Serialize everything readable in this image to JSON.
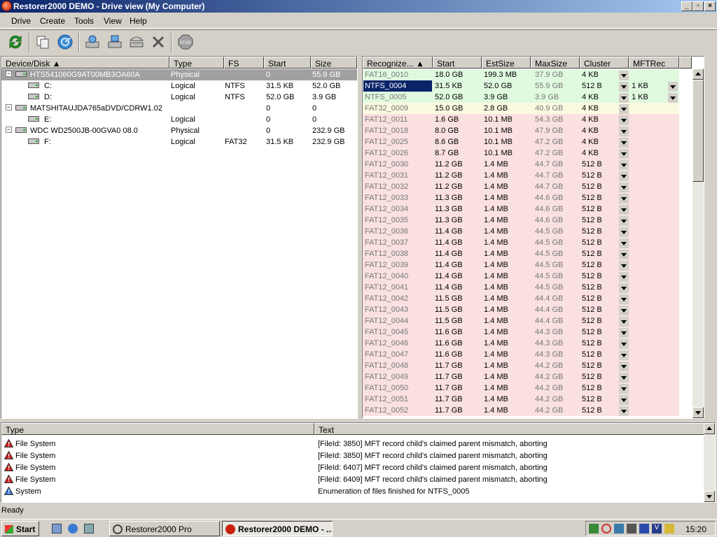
{
  "window": {
    "title": "Restorer2000 DEMO - Drive view (My Computer)"
  },
  "menu": [
    "Drive",
    "Create",
    "Tools",
    "View",
    "Help"
  ],
  "devices": {
    "columns": [
      "Device/Disk",
      "Type",
      "FS",
      "Start",
      "Size"
    ],
    "rows": [
      {
        "name": "HTS541060G9AT00MB3OA60A",
        "type": "Physical",
        "fs": "",
        "start": "0",
        "size": "55.9 GB"
      },
      {
        "name": "C:",
        "type": "Logical",
        "fs": "NTFS",
        "start": "31.5 KB",
        "size": "52.0 GB"
      },
      {
        "name": "D:",
        "type": "Logical",
        "fs": "NTFS",
        "start": "52.0 GB",
        "size": "3.9 GB"
      },
      {
        "name": "MATSHITAUJDA765aDVD/CDRW1.02",
        "type": "",
        "fs": "",
        "start": "0",
        "size": "0"
      },
      {
        "name": "E:",
        "type": "Logical",
        "fs": "",
        "start": "0",
        "size": "0"
      },
      {
        "name": "WDC WD2500JB-00GVA0 08.0",
        "type": "Physical",
        "fs": "",
        "start": "0",
        "size": "232.9 GB"
      },
      {
        "name": "F:",
        "type": "Logical",
        "fs": "FAT32",
        "start": "31.5 KB",
        "size": "232.9 GB"
      }
    ]
  },
  "partitions": {
    "columns": [
      "Recognize...",
      "Start",
      "EstSize",
      "MaxSize",
      "Cluster",
      "MFTRec"
    ],
    "rows": [
      {
        "name": "FAT16_0010",
        "start": "18.0 GB",
        "est": "199.3 MB",
        "max": "37.9 GB",
        "cluster": "4 KB",
        "mft": ""
      },
      {
        "name": "NTFS_0004",
        "start": "31.5 KB",
        "est": "52.0 GB",
        "max": "55.9 GB",
        "cluster": "512 B",
        "mft": "1 KB"
      },
      {
        "name": "NTFS_0005",
        "start": "52.0 GB",
        "est": "3.9 GB",
        "max": "3.9 GB",
        "cluster": "4 KB",
        "mft": "1 KB"
      },
      {
        "name": "FAT32_0009",
        "start": "15.0 GB",
        "est": "2.8 GB",
        "max": "40.9 GB",
        "cluster": "4 KB",
        "mft": ""
      },
      {
        "name": "FAT12_0011",
        "start": "1.6 GB",
        "est": "10.1 MB",
        "max": "54.3 GB",
        "cluster": "4 KB",
        "mft": ""
      },
      {
        "name": "FAT12_0018",
        "start": "8.0 GB",
        "est": "10.1 MB",
        "max": "47.9 GB",
        "cluster": "4 KB",
        "mft": ""
      },
      {
        "name": "FAT12_0025",
        "start": "8.6 GB",
        "est": "10.1 MB",
        "max": "47.2 GB",
        "cluster": "4 KB",
        "mft": ""
      },
      {
        "name": "FAT12_0026",
        "start": "8.7 GB",
        "est": "10.1 MB",
        "max": "47.2 GB",
        "cluster": "4 KB",
        "mft": ""
      },
      {
        "name": "FAT12_0030",
        "start": "11.2 GB",
        "est": "1.4 MB",
        "max": "44.7 GB",
        "cluster": "512 B",
        "mft": ""
      },
      {
        "name": "FAT12_0031",
        "start": "11.2 GB",
        "est": "1.4 MB",
        "max": "44.7 GB",
        "cluster": "512 B",
        "mft": ""
      },
      {
        "name": "FAT12_0032",
        "start": "11.2 GB",
        "est": "1.4 MB",
        "max": "44.7 GB",
        "cluster": "512 B",
        "mft": ""
      },
      {
        "name": "FAT12_0033",
        "start": "11.3 GB",
        "est": "1.4 MB",
        "max": "44.6 GB",
        "cluster": "512 B",
        "mft": ""
      },
      {
        "name": "FAT12_0034",
        "start": "11.3 GB",
        "est": "1.4 MB",
        "max": "44.6 GB",
        "cluster": "512 B",
        "mft": ""
      },
      {
        "name": "FAT12_0035",
        "start": "11.3 GB",
        "est": "1.4 MB",
        "max": "44.6 GB",
        "cluster": "512 B",
        "mft": ""
      },
      {
        "name": "FAT12_0036",
        "start": "11.4 GB",
        "est": "1.4 MB",
        "max": "44.5 GB",
        "cluster": "512 B",
        "mft": ""
      },
      {
        "name": "FAT12_0037",
        "start": "11.4 GB",
        "est": "1.4 MB",
        "max": "44.5 GB",
        "cluster": "512 B",
        "mft": ""
      },
      {
        "name": "FAT12_0038",
        "start": "11.4 GB",
        "est": "1.4 MB",
        "max": "44.5 GB",
        "cluster": "512 B",
        "mft": ""
      },
      {
        "name": "FAT12_0039",
        "start": "11.4 GB",
        "est": "1.4 MB",
        "max": "44.5 GB",
        "cluster": "512 B",
        "mft": ""
      },
      {
        "name": "FAT12_0040",
        "start": "11.4 GB",
        "est": "1.4 MB",
        "max": "44.5 GB",
        "cluster": "512 B",
        "mft": ""
      },
      {
        "name": "FAT12_0041",
        "start": "11.4 GB",
        "est": "1.4 MB",
        "max": "44.5 GB",
        "cluster": "512 B",
        "mft": ""
      },
      {
        "name": "FAT12_0042",
        "start": "11.5 GB",
        "est": "1.4 MB",
        "max": "44.4 GB",
        "cluster": "512 B",
        "mft": ""
      },
      {
        "name": "FAT12_0043",
        "start": "11.5 GB",
        "est": "1.4 MB",
        "max": "44.4 GB",
        "cluster": "512 B",
        "mft": ""
      },
      {
        "name": "FAT12_0044",
        "start": "11.5 GB",
        "est": "1.4 MB",
        "max": "44.4 GB",
        "cluster": "512 B",
        "mft": ""
      },
      {
        "name": "FAT12_0045",
        "start": "11.6 GB",
        "est": "1.4 MB",
        "max": "44.3 GB",
        "cluster": "512 B",
        "mft": ""
      },
      {
        "name": "FAT12_0046",
        "start": "11.6 GB",
        "est": "1.4 MB",
        "max": "44.3 GB",
        "cluster": "512 B",
        "mft": ""
      },
      {
        "name": "FAT12_0047",
        "start": "11.6 GB",
        "est": "1.4 MB",
        "max": "44.3 GB",
        "cluster": "512 B",
        "mft": ""
      },
      {
        "name": "FAT12_0048",
        "start": "11.7 GB",
        "est": "1.4 MB",
        "max": "44.2 GB",
        "cluster": "512 B",
        "mft": ""
      },
      {
        "name": "FAT12_0049",
        "start": "11.7 GB",
        "est": "1.4 MB",
        "max": "44.2 GB",
        "cluster": "512 B",
        "mft": ""
      },
      {
        "name": "FAT12_0050",
        "start": "11.7 GB",
        "est": "1.4 MB",
        "max": "44.2 GB",
        "cluster": "512 B",
        "mft": ""
      },
      {
        "name": "FAT12_0051",
        "start": "11.7 GB",
        "est": "1.4 MB",
        "max": "44.2 GB",
        "cluster": "512 B",
        "mft": ""
      },
      {
        "name": "FAT12_0052",
        "start": "11.7 GB",
        "est": "1.4 MB",
        "max": "44.2 GB",
        "cluster": "512 B",
        "mft": ""
      }
    ]
  },
  "colors": {
    "good": "#e0fae0",
    "warn": "#fafae0",
    "bad": "#fae0e0",
    "selected": "#0a246a"
  },
  "log": {
    "columns": [
      "Type",
      "Text"
    ],
    "rows": [
      {
        "type": "File System",
        "text": "[FileId: 3850] MFT record child's claimed parent mismatch, aborting",
        "icon": "error"
      },
      {
        "type": "File System",
        "text": "[FileId: 3850] MFT record child's claimed parent mismatch, aborting",
        "icon": "error"
      },
      {
        "type": "File System",
        "text": "[FileId: 6407] MFT record child's claimed parent mismatch, aborting",
        "icon": "error"
      },
      {
        "type": "File System",
        "text": "[FileId: 6409] MFT record child's claimed parent mismatch, aborting",
        "icon": "error"
      },
      {
        "type": "System",
        "text": "Enumeration of files finished for NTFS_0005",
        "icon": "info"
      }
    ]
  },
  "status": {
    "text": "Ready"
  },
  "taskbar": {
    "start": "Start",
    "tasks": [
      "Restorer2000 Pro",
      "Restorer2000 DEMO - ..."
    ],
    "clock": "15:20"
  }
}
